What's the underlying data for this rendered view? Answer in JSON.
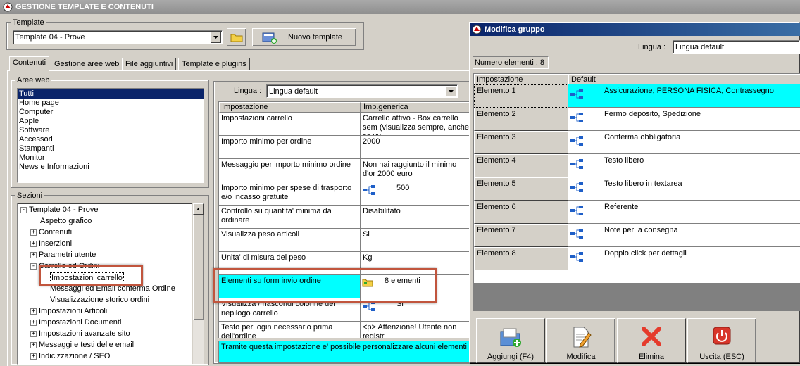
{
  "main_window": {
    "title": "GESTIONE TEMPLATE E CONTENUTI",
    "template_label": "Template",
    "template_value": "Template 04 - Prove",
    "new_template_button": "Nuovo template"
  },
  "tabs": [
    {
      "label": "Contenuti",
      "active": true
    },
    {
      "label": "Gestione aree web",
      "active": false
    },
    {
      "label": "File aggiuntivi",
      "active": false
    },
    {
      "label": "Template e plugins",
      "active": false
    }
  ],
  "aree_web": {
    "label": "Aree web",
    "items": [
      "Tutti",
      "Home page",
      "Computer",
      "Apple",
      "Software",
      "Accessori",
      "Stampanti",
      "Monitor",
      "News e Informazioni"
    ],
    "selected": "Tutti"
  },
  "sezioni": {
    "label": "Sezioni",
    "tree": [
      {
        "text": "Template 04 - Prove",
        "level": 0,
        "expander": "-"
      },
      {
        "text": "Aspetto grafico",
        "level": 1,
        "expander": ""
      },
      {
        "text": "Contenuti",
        "level": 1,
        "expander": "+"
      },
      {
        "text": "Inserzioni",
        "level": 1,
        "expander": "+"
      },
      {
        "text": "Parametri utente",
        "level": 1,
        "expander": "+"
      },
      {
        "text": "Carrello ed Ordini",
        "level": 1,
        "expander": "-"
      },
      {
        "text": "Impostazioni carrello",
        "level": 2,
        "expander": ""
      },
      {
        "text": "Messaggi ed Email conferma Ordine",
        "level": 2,
        "expander": ""
      },
      {
        "text": "Visualizzazione storico ordini",
        "level": 2,
        "expander": ""
      },
      {
        "text": "Impostazioni Articoli",
        "level": 1,
        "expander": "+"
      },
      {
        "text": "Impostazioni Documenti",
        "level": 1,
        "expander": "+"
      },
      {
        "text": "Impostazioni avanzate sito",
        "level": 1,
        "expander": "+"
      },
      {
        "text": "Messaggi e testi delle email",
        "level": 1,
        "expander": "+"
      },
      {
        "text": "Indicizzazione / SEO",
        "level": 1,
        "expander": "+"
      }
    ]
  },
  "settings_panel": {
    "lingua_label": "Lingua :",
    "lingua_value": "Lingua default",
    "col_impostazione": "Impostazione",
    "col_value": "Imp.generica",
    "rows": [
      {
        "name": "Impostazioni carrello",
        "value": "Carrello attivo - Box carrello sem (visualizza sempre, anche se vu",
        "icon": false
      },
      {
        "name": "Importo minimo per ordine",
        "value": "2000",
        "icon": false
      },
      {
        "name": "Messaggio per importo minimo ordine",
        "value": "Non hai raggiunto il minimo d'or 2000 euro",
        "icon": false
      },
      {
        "name": "Importo minimo per spese di trasporto e/o incasso gratuite",
        "value": "500",
        "icon": true
      },
      {
        "name": "Controllo su quantita' minima da ordinare",
        "value": "Disabilitato",
        "icon": false
      },
      {
        "name": "Visualizza peso articoli",
        "value": "Si",
        "icon": false
      },
      {
        "name": "Unita' di misura del peso",
        "value": "Kg",
        "icon": false
      },
      {
        "name": "Elementi su form invio ordine",
        "value": "8 elementi",
        "icon": true,
        "highlight": true
      },
      {
        "name": "Visualizza / nascondi colonne del riepilogo carrello",
        "value": "Si",
        "icon": true
      },
      {
        "name": "Testo per login necessario prima dell'ordine",
        "value": "<p> Attenzione! Utente non registr",
        "icon": false
      }
    ],
    "description": "Tramite questa impostazione e' possibile personalizzare alcuni elementi c"
  },
  "dialog": {
    "title": "Modifica gruppo",
    "lingua_label": "Lingua :",
    "lingua_value": "Lingua default",
    "numero_elementi": "Numero elementi : 8",
    "col_impostazione": "Impostazione",
    "col_default": "Default",
    "rows": [
      {
        "name": "Elemento 1",
        "value": "Assicurazione, PERSONA FISICA, Contrassegno",
        "selected": true
      },
      {
        "name": "Elemento 2",
        "value": "Fermo deposito, Spedizione",
        "selected": false
      },
      {
        "name": "Elemento 3",
        "value": "Conferma obbligatoria",
        "selected": false
      },
      {
        "name": "Elemento 4",
        "value": "Testo libero",
        "selected": false
      },
      {
        "name": "Elemento 5",
        "value": "Testo libero in textarea",
        "selected": false
      },
      {
        "name": "Elemento 6",
        "value": "Referente",
        "selected": false
      },
      {
        "name": "Elemento 7",
        "value": "Note per la consegna",
        "selected": false
      },
      {
        "name": "Elemento 8",
        "value": "Doppio click per dettagli",
        "selected": false
      }
    ],
    "buttons": [
      {
        "label": "Aggiungi (F4)",
        "icon": "add-folder-icon"
      },
      {
        "label": "Modifica",
        "icon": "edit-document-icon"
      },
      {
        "label": "Elimina",
        "icon": "delete-x-icon"
      },
      {
        "label": "Uscita (ESC)",
        "icon": "exit-power-icon"
      }
    ]
  },
  "colors": {
    "highlight_cyan": "#00ffff",
    "selection_blue": "#0a246a",
    "annotation_red": "#c1553d",
    "dialog_title_blue": "#0a246a"
  }
}
